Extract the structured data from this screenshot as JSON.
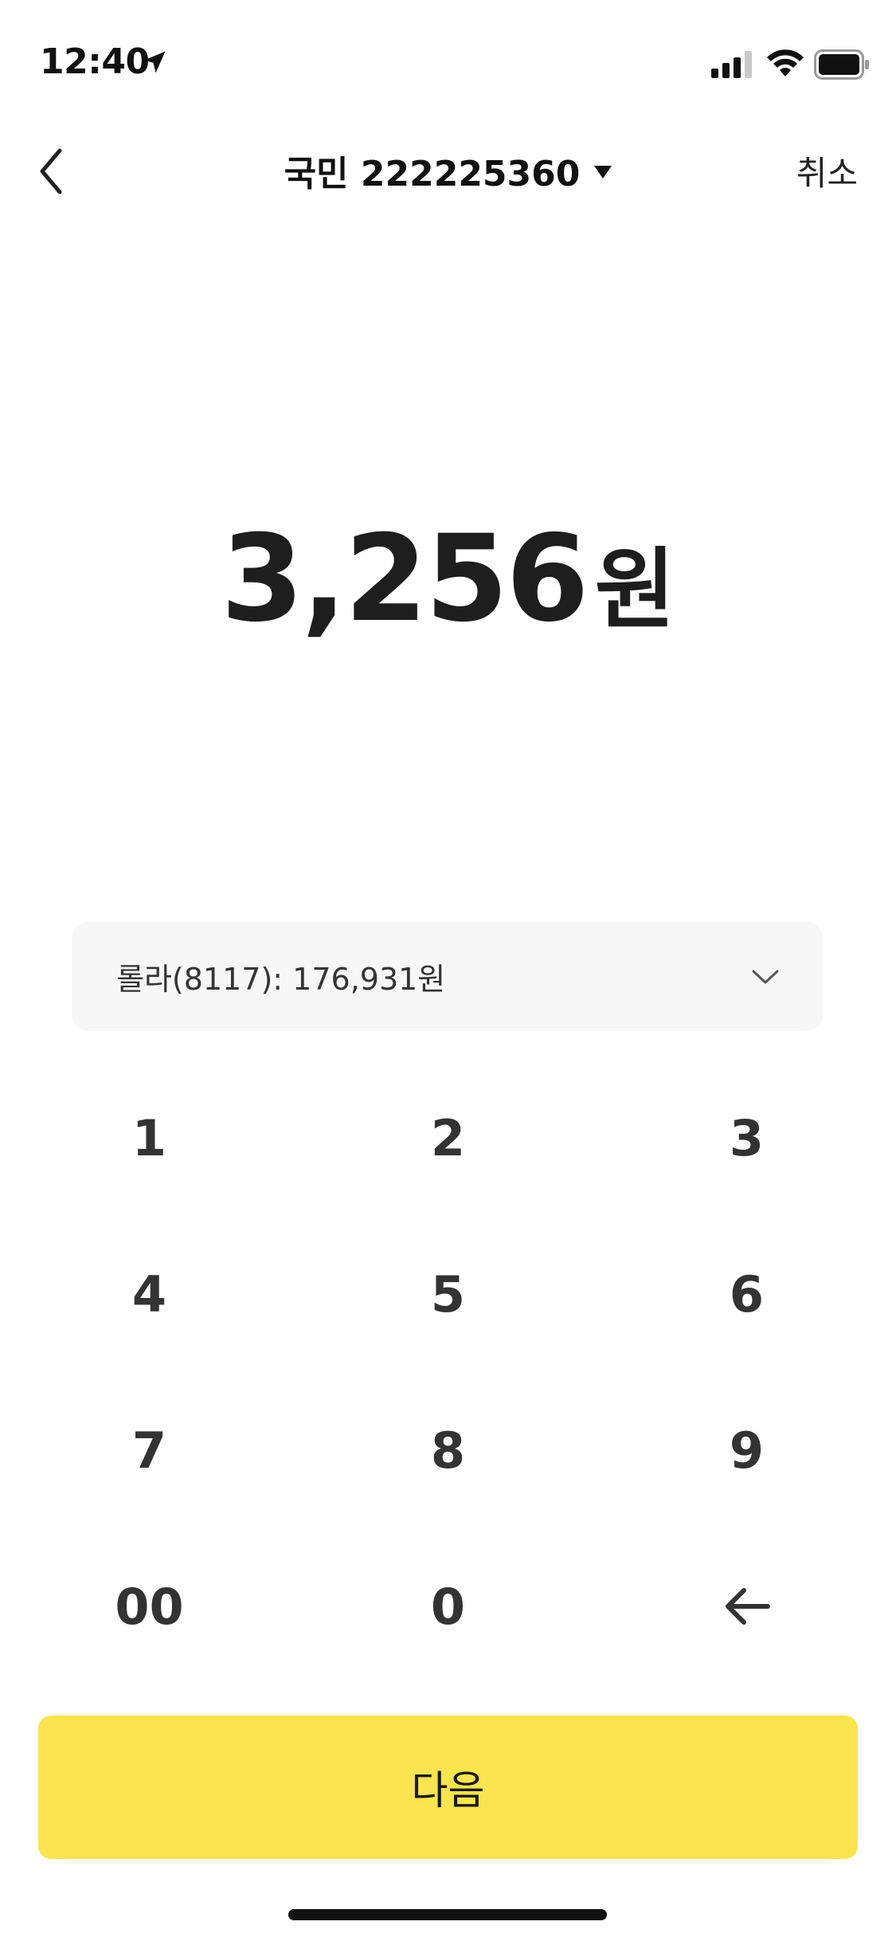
{
  "status_bar": {
    "time": "12:40"
  },
  "nav": {
    "title": "국민 222225360",
    "cancel_label": "취소"
  },
  "amount": {
    "value": "3,256",
    "unit": "원"
  },
  "account": {
    "label": "롤라(8117): 176,931원"
  },
  "keypad": {
    "keys": [
      "1",
      "2",
      "3",
      "4",
      "5",
      "6",
      "7",
      "8",
      "9",
      "00",
      "0"
    ]
  },
  "next_label": "다음",
  "colors": {
    "accent": "#fae44f",
    "text": "#222222",
    "selector_bg": "#f7f7f7"
  }
}
